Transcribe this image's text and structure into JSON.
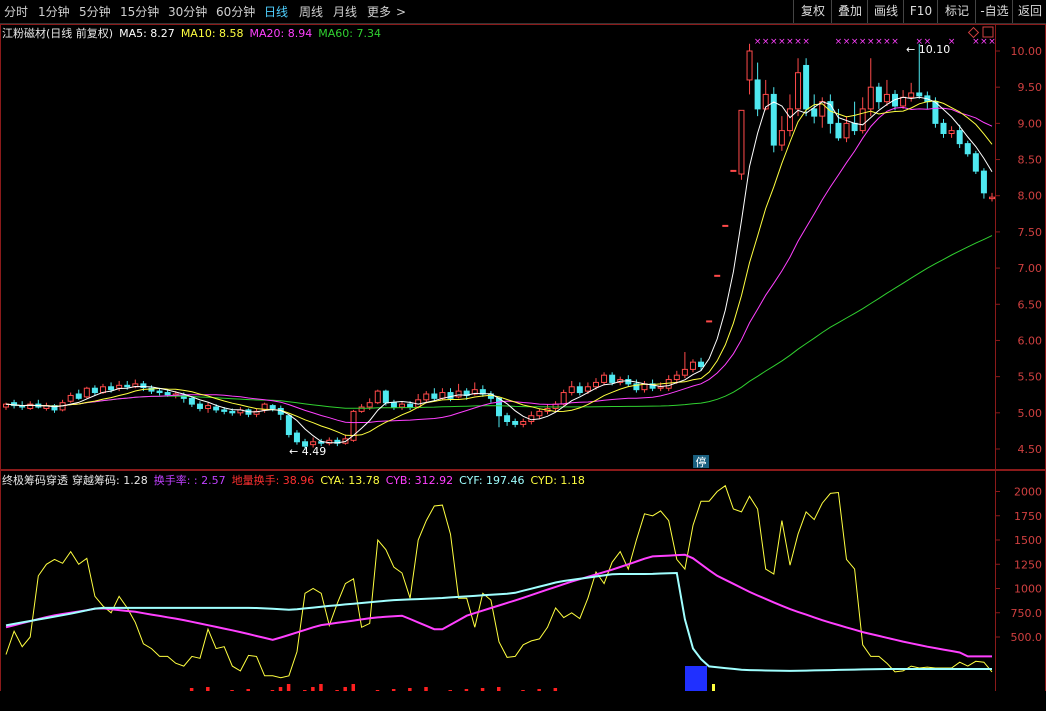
{
  "toolbar": {
    "periods": [
      "分时",
      "1分钟",
      "5分钟",
      "15分钟",
      "30分钟",
      "60分钟",
      "日线",
      "周线",
      "月线",
      "更多"
    ],
    "active_period": "日线",
    "right_buttons": [
      "复权",
      "叠加",
      "画线",
      "F10",
      "标记",
      "-自选",
      "返回"
    ]
  },
  "main_info": {
    "title": "江粉磁材(日线 前复权)",
    "ma5": "MA5: 8.27",
    "ma10": "MA10: 8.58",
    "ma20": "MA20: 8.94",
    "ma60": "MA60: 7.34"
  },
  "ind_info": {
    "title": "终极筹码穿透",
    "cross": "穿越筹码: 1.28",
    "turnover": "换手率: : 2.57",
    "ground": "地量换手: 38.96",
    "cya": "CYA: 13.78",
    "cyb": "CYB: 312.92",
    "cyf": "CYF: 197.46",
    "cyd": "CYD: 1.18"
  },
  "colors": {
    "up": "#ff4a4a",
    "down": "#4fe8f0",
    "ma5": "#ffffff",
    "ma10": "#ffff40",
    "ma20": "#ff40ff",
    "ma60": "#30d030",
    "cyb": "#ff40ff",
    "cyf": "#a0ffff",
    "cya": "#ffff40"
  },
  "chart_data": [
    {
      "type": "candlestick",
      "title": "江粉磁材(日线 前复权)",
      "ylim": [
        4.3,
        10.2
      ],
      "ytick_labels": [
        "4.50",
        "5.00",
        "5.50",
        "6.00",
        "6.50",
        "7.00",
        "7.50",
        "8.00",
        "8.50",
        "9.00",
        "9.50",
        "10.00"
      ],
      "annotations": {
        "high_label": "10.10",
        "low_label": "4.49",
        "limit_tag": "停"
      },
      "candles": [
        [
          5.08,
          5.12,
          5.14,
          5.04
        ],
        [
          5.14,
          5.1,
          5.18,
          5.06
        ],
        [
          5.1,
          5.08,
          5.16,
          5.04
        ],
        [
          5.06,
          5.12,
          5.16,
          5.04
        ],
        [
          5.12,
          5.08,
          5.18,
          5.06
        ],
        [
          5.06,
          5.1,
          5.14,
          5.03
        ],
        [
          5.1,
          5.04,
          5.12,
          5.0
        ],
        [
          5.04,
          5.14,
          5.18,
          5.02
        ],
        [
          5.16,
          5.24,
          5.28,
          5.14
        ],
        [
          5.26,
          5.2,
          5.32,
          5.18
        ],
        [
          5.22,
          5.34,
          5.36,
          5.2
        ],
        [
          5.34,
          5.28,
          5.38,
          5.24
        ],
        [
          5.28,
          5.36,
          5.4,
          5.26
        ],
        [
          5.36,
          5.32,
          5.42,
          5.28
        ],
        [
          5.34,
          5.38,
          5.44,
          5.3
        ],
        [
          5.38,
          5.36,
          5.44,
          5.32
        ],
        [
          5.36,
          5.4,
          5.46,
          5.34
        ],
        [
          5.4,
          5.35,
          5.44,
          5.3
        ],
        [
          5.34,
          5.3,
          5.38,
          5.26
        ],
        [
          5.3,
          5.28,
          5.34,
          5.24
        ],
        [
          5.28,
          5.25,
          5.32,
          5.22
        ],
        [
          5.24,
          5.26,
          5.3,
          5.2
        ],
        [
          5.24,
          5.2,
          5.28,
          5.14
        ],
        [
          5.2,
          5.12,
          5.22,
          5.08
        ],
        [
          5.12,
          5.06,
          5.16,
          5.02
        ],
        [
          5.06,
          5.1,
          5.14,
          5.0
        ],
        [
          5.08,
          5.04,
          5.12,
          5.0
        ],
        [
          5.04,
          5.02,
          5.08,
          4.98
        ],
        [
          5.02,
          5.0,
          5.06,
          4.96
        ],
        [
          5.0,
          5.04,
          5.08,
          4.96
        ],
        [
          5.04,
          4.98,
          5.06,
          4.94
        ],
        [
          4.98,
          5.02,
          5.06,
          4.94
        ],
        [
          5.04,
          5.12,
          5.14,
          5.0
        ],
        [
          5.1,
          5.06,
          5.12,
          5.02
        ],
        [
          5.06,
          4.98,
          5.1,
          4.9
        ],
        [
          4.96,
          4.7,
          4.98,
          4.66
        ],
        [
          4.72,
          4.6,
          4.76,
          4.56
        ],
        [
          4.6,
          4.54,
          4.64,
          4.49
        ],
        [
          4.56,
          4.6,
          4.66,
          4.52
        ],
        [
          4.6,
          4.58,
          4.64,
          4.54
        ],
        [
          4.58,
          4.62,
          4.66,
          4.55
        ],
        [
          4.62,
          4.58,
          4.66,
          4.54
        ],
        [
          4.58,
          4.64,
          4.7,
          4.56
        ],
        [
          4.62,
          5.02,
          5.04,
          4.6
        ],
        [
          5.02,
          5.08,
          5.12,
          5.0
        ],
        [
          5.08,
          5.14,
          5.2,
          5.04
        ],
        [
          5.14,
          5.3,
          5.32,
          5.12
        ],
        [
          5.3,
          5.14,
          5.32,
          5.1
        ],
        [
          5.14,
          5.08,
          5.18,
          5.04
        ],
        [
          5.08,
          5.12,
          5.16,
          5.04
        ],
        [
          5.12,
          5.08,
          5.16,
          5.04
        ],
        [
          5.08,
          5.18,
          5.26,
          5.06
        ],
        [
          5.18,
          5.26,
          5.3,
          5.14
        ],
        [
          5.26,
          5.2,
          5.34,
          5.16
        ],
        [
          5.2,
          5.28,
          5.34,
          5.18
        ],
        [
          5.28,
          5.2,
          5.34,
          5.16
        ],
        [
          5.22,
          5.3,
          5.4,
          5.2
        ],
        [
          5.3,
          5.24,
          5.34,
          5.18
        ],
        [
          5.26,
          5.32,
          5.42,
          5.24
        ],
        [
          5.32,
          5.26,
          5.38,
          5.22
        ],
        [
          5.26,
          5.2,
          5.3,
          5.14
        ],
        [
          5.2,
          4.96,
          5.22,
          4.8
        ],
        [
          4.96,
          4.88,
          5.0,
          4.82
        ],
        [
          4.88,
          4.84,
          4.92,
          4.8
        ],
        [
          4.84,
          4.88,
          4.92,
          4.8
        ],
        [
          4.88,
          4.96,
          5.02,
          4.84
        ],
        [
          4.96,
          5.02,
          5.06,
          4.92
        ],
        [
          5.02,
          5.06,
          5.12,
          4.98
        ],
        [
          5.06,
          5.12,
          5.16,
          5.02
        ],
        [
          5.12,
          5.28,
          5.32,
          5.1
        ],
        [
          5.28,
          5.36,
          5.44,
          5.24
        ],
        [
          5.36,
          5.28,
          5.42,
          5.24
        ],
        [
          5.3,
          5.36,
          5.42,
          5.26
        ],
        [
          5.36,
          5.42,
          5.48,
          5.32
        ],
        [
          5.42,
          5.52,
          5.56,
          5.38
        ],
        [
          5.52,
          5.42,
          5.56,
          5.38
        ],
        [
          5.42,
          5.46,
          5.5,
          5.38
        ],
        [
          5.46,
          5.4,
          5.52,
          5.36
        ],
        [
          5.4,
          5.32,
          5.46,
          5.28
        ],
        [
          5.32,
          5.4,
          5.44,
          5.28
        ],
        [
          5.4,
          5.34,
          5.46,
          5.3
        ],
        [
          5.34,
          5.36,
          5.42,
          5.3
        ],
        [
          5.34,
          5.46,
          5.52,
          5.3
        ],
        [
          5.46,
          5.52,
          5.58,
          5.4
        ],
        [
          5.52,
          5.6,
          5.84,
          5.48
        ],
        [
          5.6,
          5.7,
          5.74,
          5.56
        ],
        [
          5.7,
          5.64,
          5.76,
          5.58
        ],
        [
          6.27,
          6.27,
          6.27,
          6.27
        ],
        [
          6.9,
          6.9,
          6.9,
          6.9
        ],
        [
          7.59,
          7.59,
          7.59,
          7.59
        ],
        [
          8.35,
          8.35,
          8.35,
          8.35
        ],
        [
          8.3,
          9.18,
          9.18,
          8.22
        ],
        [
          9.6,
          10.0,
          10.1,
          9.4
        ],
        [
          9.6,
          9.2,
          9.84,
          9.1
        ],
        [
          9.2,
          9.4,
          9.6,
          9.18
        ],
        [
          9.4,
          8.7,
          9.5,
          8.6
        ],
        [
          8.7,
          8.9,
          9.1,
          8.62
        ],
        [
          8.9,
          9.2,
          9.4,
          8.82
        ],
        [
          9.2,
          9.7,
          9.9,
          9.1
        ],
        [
          9.8,
          9.2,
          9.9,
          9.1
        ],
        [
          9.2,
          9.1,
          9.4,
          9.0
        ],
        [
          9.1,
          9.3,
          9.36,
          8.94
        ],
        [
          9.3,
          9.0,
          9.4,
          8.86
        ],
        [
          9.0,
          8.8,
          9.2,
          8.76
        ],
        [
          8.8,
          9.0,
          9.1,
          8.74
        ],
        [
          9.0,
          8.9,
          9.3,
          8.84
        ],
        [
          8.9,
          9.2,
          9.36,
          8.86
        ],
        [
          9.2,
          9.5,
          9.9,
          9.1
        ],
        [
          9.5,
          9.3,
          9.56,
          9.2
        ],
        [
          9.3,
          9.4,
          9.6,
          9.24
        ],
        [
          9.4,
          9.24,
          9.46,
          9.18
        ],
        [
          9.24,
          9.36,
          9.46,
          9.2
        ],
        [
          9.36,
          9.42,
          9.56,
          9.3
        ],
        [
          9.42,
          9.38,
          10.1,
          9.34
        ],
        [
          9.38,
          9.3,
          9.44,
          9.2
        ],
        [
          9.3,
          9.0,
          9.36,
          8.94
        ],
        [
          9.0,
          8.86,
          9.06,
          8.8
        ],
        [
          8.86,
          8.9,
          8.96,
          8.8
        ],
        [
          8.9,
          8.72,
          8.98,
          8.66
        ],
        [
          8.72,
          8.58,
          8.76,
          8.54
        ],
        [
          8.58,
          8.34,
          8.62,
          8.3
        ],
        [
          8.34,
          8.04,
          8.38,
          7.96
        ],
        [
          7.96,
          7.98,
          8.04,
          7.92
        ]
      ]
    },
    {
      "type": "line",
      "title": "终极筹码穿透",
      "ylim": [
        0,
        2100
      ],
      "ytick_labels": [
        "500.0",
        "750.0",
        "1000",
        "1250",
        "1500",
        "1750",
        "2000"
      ]
    }
  ]
}
